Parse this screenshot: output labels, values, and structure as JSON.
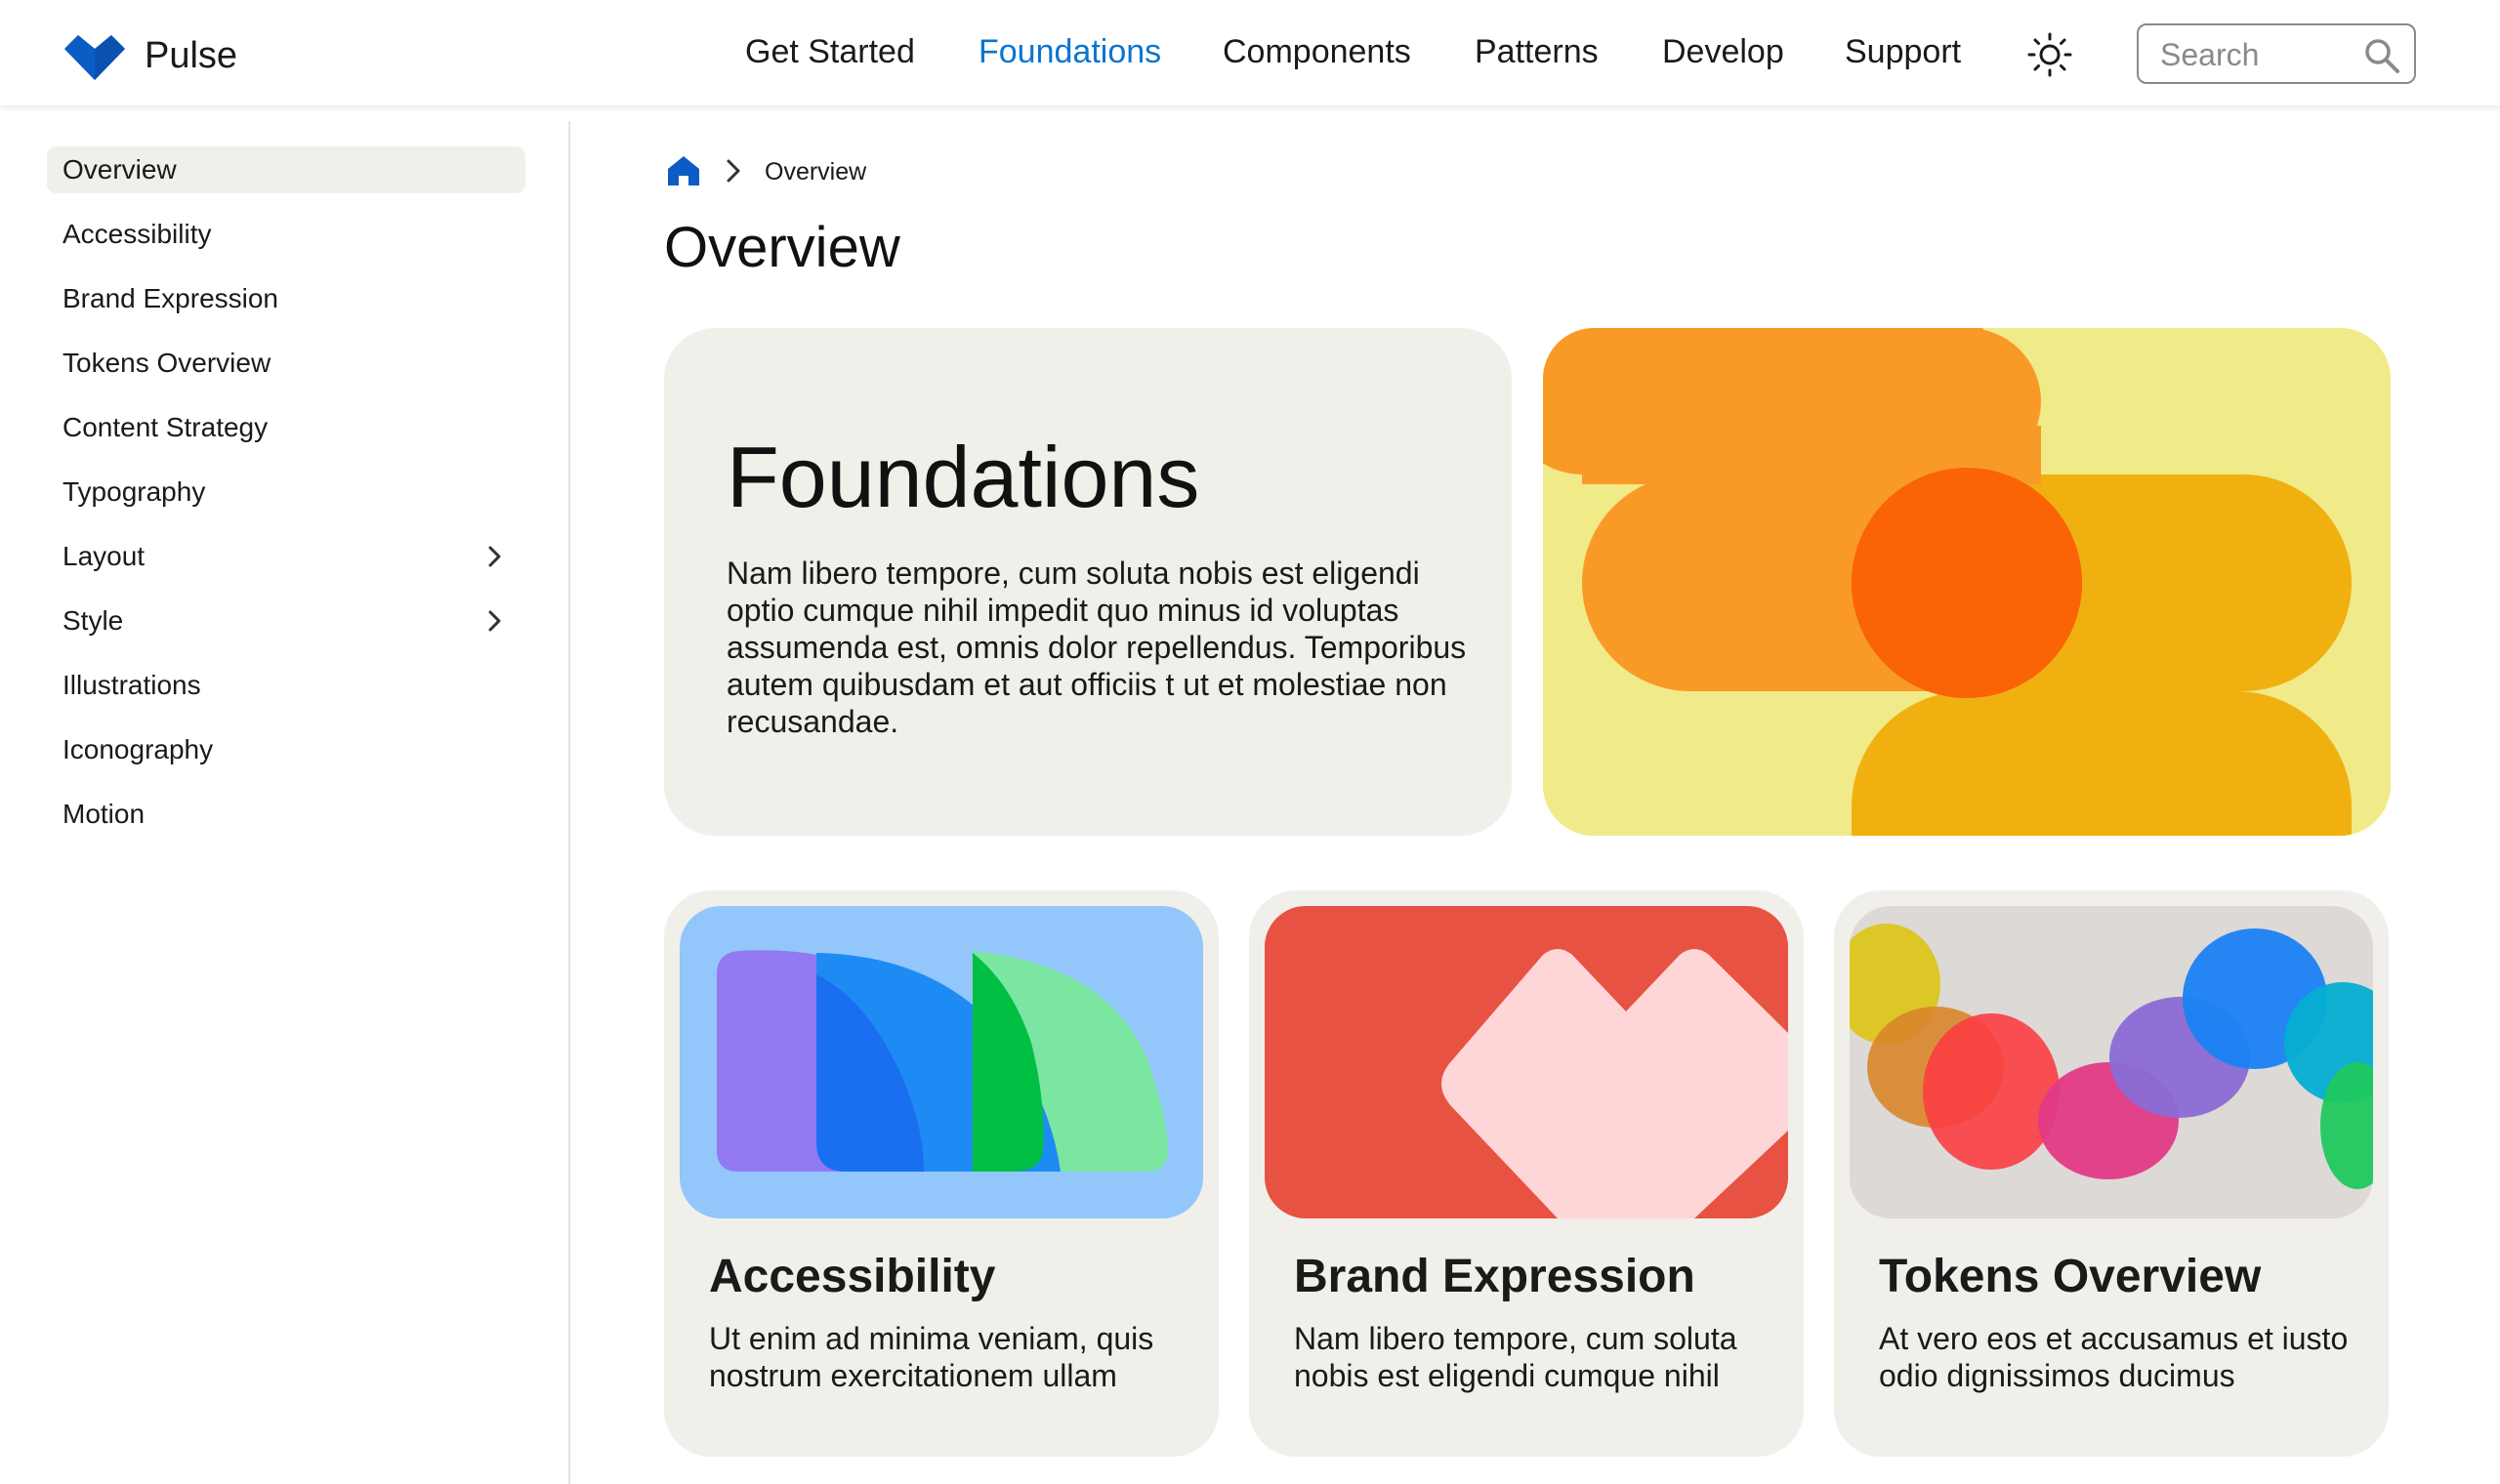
{
  "header": {
    "brand": "Pulse",
    "nav": [
      {
        "label": "Get Started"
      },
      {
        "label": "Foundations",
        "active": true
      },
      {
        "label": "Components"
      },
      {
        "label": "Patterns"
      },
      {
        "label": "Develop"
      },
      {
        "label": "Support"
      }
    ],
    "search_placeholder": "Search",
    "accent_color": "#0b74d1"
  },
  "sidebar": {
    "items": [
      {
        "label": "Overview",
        "active": true
      },
      {
        "label": "Accessibility"
      },
      {
        "label": "Brand Expression"
      },
      {
        "label": "Tokens Overview"
      },
      {
        "label": "Content Strategy"
      },
      {
        "label": "Typography"
      },
      {
        "label": "Layout",
        "expandable": true
      },
      {
        "label": "Style",
        "expandable": true
      },
      {
        "label": "Illustrations"
      },
      {
        "label": "Iconography"
      },
      {
        "label": "Motion"
      }
    ]
  },
  "breadcrumb": {
    "current": "Overview"
  },
  "main": {
    "title": "Overview",
    "hero": {
      "title": "Foundations",
      "text": "Nam libero tempore, cum soluta nobis est eligendi optio cumque nihil impedit quo minus id voluptas assumenda est, omnis dolor repellendus. Temporibus autem quibusdam et aut officiis t ut et molestiae non recusandae."
    },
    "cards": [
      {
        "title": "Accessibility",
        "text": "Ut enim ad minima veniam, quis nostrum exercitationem ullam"
      },
      {
        "title": "Brand Expression",
        "text": "Nam libero tempore, cum soluta nobis est eligendi cumque nihil"
      },
      {
        "title": "Tokens Overview",
        "text": "At vero eos et accusamus et iusto odio dignissimos ducimus"
      }
    ]
  },
  "icons": {
    "logo": "pulse-logo-icon",
    "theme": "sun-icon",
    "search": "search-icon",
    "home": "home-icon",
    "chevron": "chevron-right-icon"
  }
}
